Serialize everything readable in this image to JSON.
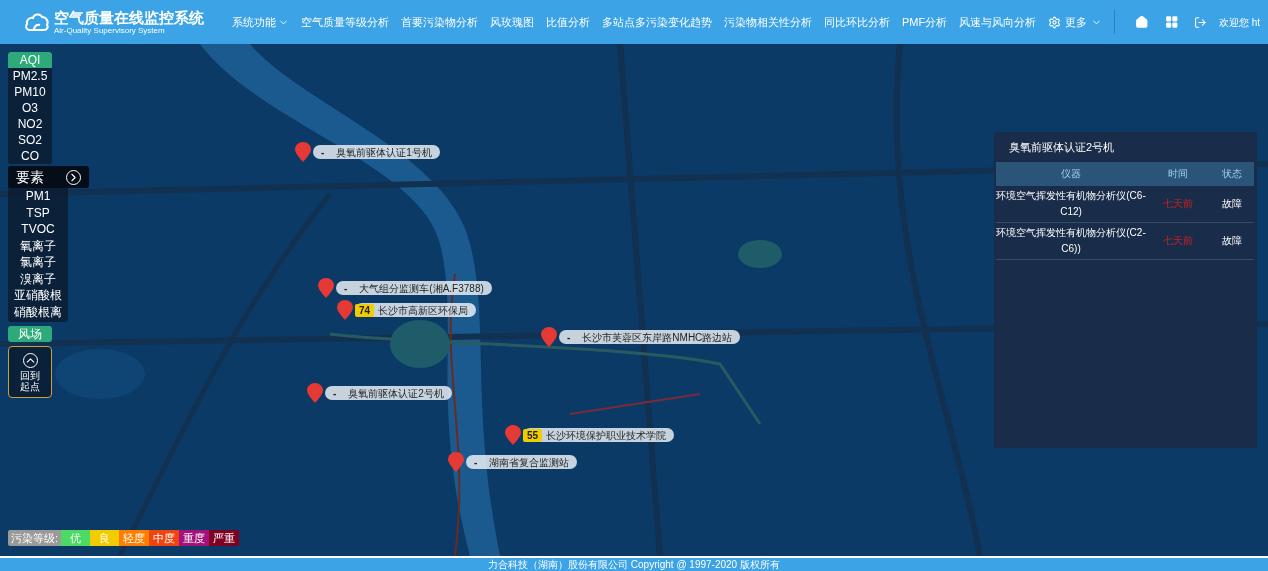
{
  "header": {
    "logo_title": "空气质量在线监控系统",
    "logo_subtitle": "Air-Quality Supervisory System",
    "nav": [
      {
        "label": "系统功能",
        "dropdown": true
      },
      {
        "label": "空气质量等级分析",
        "dropdown": false
      },
      {
        "label": "首要污染物分析",
        "dropdown": false
      },
      {
        "label": "风玫瑰图",
        "dropdown": false
      },
      {
        "label": "比值分析",
        "dropdown": false
      },
      {
        "label": "多站点多污染变化趋势",
        "dropdown": false
      },
      {
        "label": "污染物相关性分析",
        "dropdown": false
      },
      {
        "label": "同比环比分析",
        "dropdown": false
      },
      {
        "label": "PMF分析",
        "dropdown": false
      },
      {
        "label": "风速与风向分析",
        "dropdown": false
      }
    ],
    "more": "更多",
    "welcome": "欢迎您 ht"
  },
  "left_panel": {
    "group1_title": "AQI",
    "group1_items": [
      "PM2.5",
      "PM10",
      "O3",
      "NO2",
      "SO2",
      "CO"
    ],
    "group2_title": "要素",
    "group2_items": [
      "PM1",
      "TSP",
      "TVOC",
      "氧离子",
      "氯离子",
      "溴离子",
      "亚硝酸根",
      "硝酸根离"
    ],
    "wind_button": "风场",
    "home_button": "回到起点"
  },
  "markers": [
    {
      "value": "-",
      "name": "臭氧前驱体认证1号机",
      "kind": "none"
    },
    {
      "value": "-",
      "name": "大气组分监测车(湘A.F3788)",
      "kind": "none"
    },
    {
      "value": "74",
      "name": "长沙市高新区环保局",
      "kind": "aqi"
    },
    {
      "value": "-",
      "name": "长沙市芙蓉区东岸路NMHC路边站",
      "kind": "none"
    },
    {
      "value": "-",
      "name": "臭氧前驱体认证2号机",
      "kind": "none"
    },
    {
      "value": "55",
      "name": "长沙环境保护职业技术学院",
      "kind": "aqi"
    },
    {
      "value": "-",
      "name": "湖南省复合监测站",
      "kind": "none"
    }
  ],
  "info_panel": {
    "title": "臭氧前驱体认证2号机",
    "columns": [
      "仪器",
      "时间",
      "状态"
    ],
    "rows": [
      {
        "instrument": "环境空气挥发性有机物分析仪(C6-C12)",
        "time": "七天前",
        "status": "故障"
      },
      {
        "instrument": "环境空气挥发性有机物分析仪(C2-C6))",
        "time": "七天前",
        "status": "故障"
      }
    ]
  },
  "legend": {
    "label": "污染等级:",
    "levels": [
      {
        "label": "优",
        "color": "#4cd964"
      },
      {
        "label": "良",
        "color": "#f0cc00"
      },
      {
        "label": "轻度",
        "color": "#ff7e00"
      },
      {
        "label": "中度",
        "color": "#f04410"
      },
      {
        "label": "重度",
        "color": "#a3127a"
      },
      {
        "label": "严重",
        "color": "#7e0023"
      }
    ]
  },
  "footer": "力合科技（湖南）股份有限公司 Copyright @ 1997-2020 版权所有"
}
